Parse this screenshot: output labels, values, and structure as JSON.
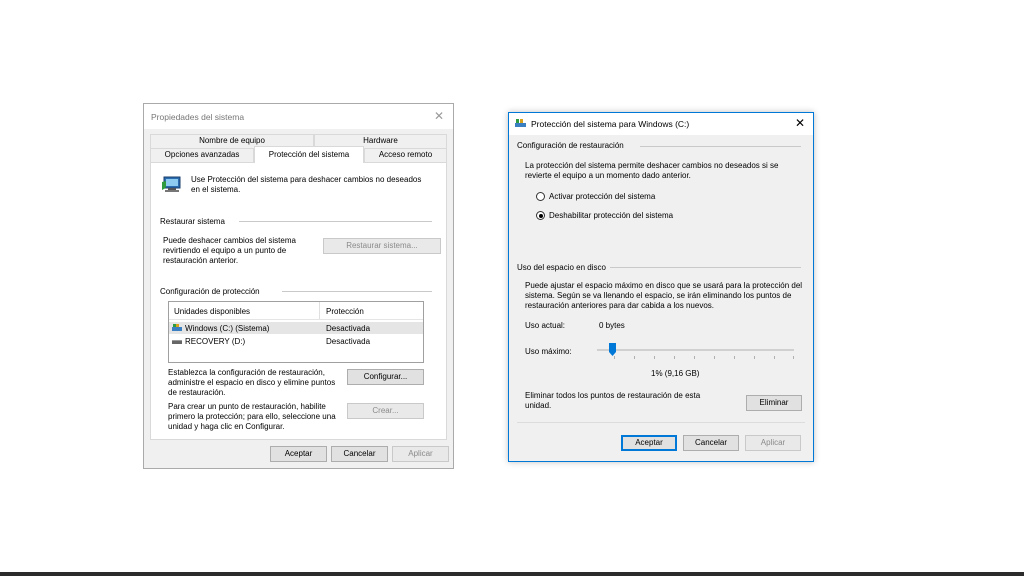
{
  "sysprops": {
    "title": "Propiedades del sistema",
    "tabs_row1": [
      "Nombre de equipo",
      "Hardware"
    ],
    "tabs_row2": [
      "Opciones avanzadas",
      "Protección del sistema",
      "Acceso remoto"
    ],
    "intro": "Use Protección del sistema para deshacer cambios no deseados en el sistema.",
    "restore_heading": "Restaurar sistema",
    "restore_text": "Puede deshacer cambios del sistema revirtiendo el equipo a un punto de restauración anterior.",
    "restore_button": "Restaurar sistema...",
    "protection_heading": "Configuración de protección",
    "table_headers": [
      "Unidades disponibles",
      "Protección"
    ],
    "drives": [
      {
        "name": "Windows (C:) (Sistema)",
        "status": "Desactivada"
      },
      {
        "name": "RECOVERY (D:)",
        "status": "Desactivada"
      }
    ],
    "config_text": "Establezca la configuración de restauración, administre el espacio en disco y elimine puntos de restauración.",
    "config_button": "Configurar...",
    "create_text": "Para crear un punto de restauración, habilite primero la protección; para ello, seleccione una unidad y haga clic en Configurar.",
    "create_button": "Crear...",
    "ok": "Aceptar",
    "cancel": "Cancelar",
    "apply": "Aplicar"
  },
  "protdlg": {
    "title": "Protección del sistema para Windows (C:)",
    "restore_config_heading": "Configuración de restauración",
    "restore_config_text": "La protección del sistema permite deshacer cambios no deseados si se revierte el equipo a un momento dado anterior.",
    "radio_enable": "Activar protección del sistema",
    "radio_disable": "Deshabilitar protección del sistema",
    "selected_option": "disable",
    "disk_heading": "Uso del espacio en disco",
    "disk_text": "Puede ajustar el espacio máximo en disco que se usará para la protección del sistema. Según se va llenando el espacio, se irán eliminando los puntos de restauración anteriores para dar cabida a los nuevos.",
    "current_label": "Uso actual:",
    "current_value": "0 bytes",
    "max_label": "Uso máximo:",
    "max_value_text": "1% (9,16 GB)",
    "slider_fraction": 0.01,
    "delete_text": "Eliminar todos los puntos de restauración de esta unidad.",
    "delete_button": "Eliminar",
    "ok": "Aceptar",
    "cancel": "Cancelar",
    "apply": "Aplicar"
  },
  "colors": {
    "accent": "#0078d7",
    "dialog_bg": "#f0f0f0",
    "selected_row": "#e5e5e5"
  }
}
